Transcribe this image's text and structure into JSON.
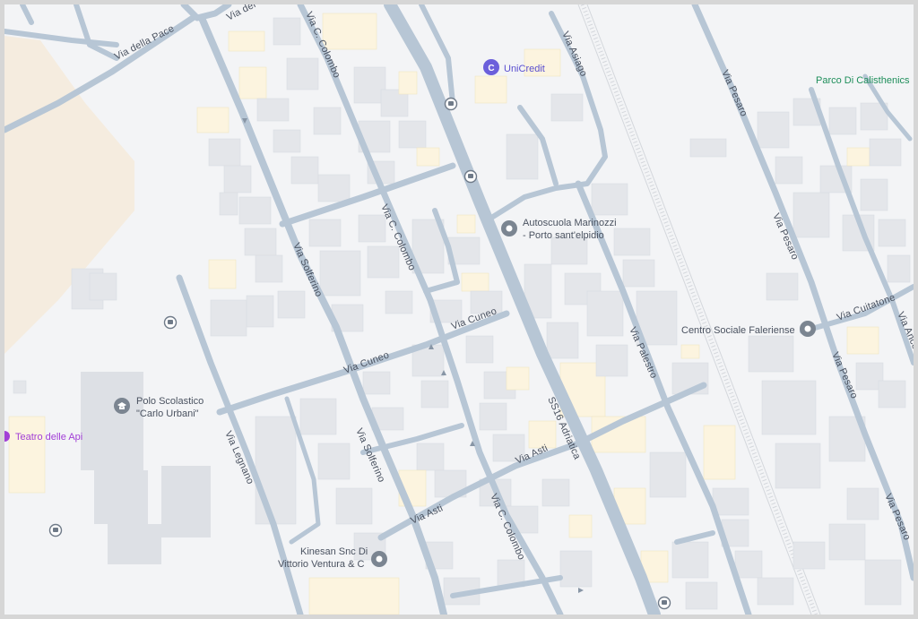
{
  "streets": {
    "via_della_pace": "Via della Pace",
    "via_d_top": "Via del",
    "via_c_colombo_top": "Via C. Colombo",
    "via_c_colombo_mid": "Via C. Colombo",
    "via_c_colombo_bottom": "Via C. Colombo",
    "via_asiago": "Via Asiago",
    "via_pesaro_top": "Via Pesaro",
    "via_pesaro_mid": "Via Pesaro",
    "via_pesaro_lower": "Via Pesaro",
    "via_pesaro_bottom": "Via Pesaro",
    "via_solferino_top": "Via Solferino",
    "via_solferino_bottom": "Via Solferino",
    "via_cuneo_left": "Via Cuneo",
    "via_cuneo_right": "Via Cuneo",
    "via_legnano": "Via Legnano",
    "via_asti_left": "Via Asti",
    "via_asti_right": "Via Asti",
    "ss16": "SS16 Adriatica",
    "via_palestro": "Via Palestro",
    "via_cuitatone": "Via Cuitatone",
    "via_ancona_partial": "Via Anco"
  },
  "pois": {
    "unicredit": "UniCredit",
    "parco": "Parco Di Calisthenics",
    "autoscuola_line1": "Autoscuola Marinozzi",
    "autoscuola_line2": "- Porto sant'elpidio",
    "centro_sociale": "Centro Sociale Faleriense",
    "polo_line1": "Polo Scolastico",
    "polo_line2": "\"Carlo Urbani\"",
    "teatro": "Teatro delle Api",
    "kinesan_line1": "Kinesan Snc Di",
    "kinesan_line2": "Vittorio Ventura & C"
  },
  "colors": {
    "map_background": "#f3f4f6",
    "road": "#b7c6d5",
    "building": "#e4e6ea",
    "highlighted_building": "#fcf4df",
    "park_area": "#f5ecdf",
    "bank_accent": "#5a4fcf",
    "park_accent": "#1e8e5a",
    "theatre_accent": "#a23fd6",
    "poi_pin": "#7b8591"
  },
  "icons": {
    "bank": "bank-icon",
    "place": "place-pin-icon",
    "school": "school-icon",
    "theatre": "theatre-icon",
    "bus": "bus-stop-icon"
  }
}
